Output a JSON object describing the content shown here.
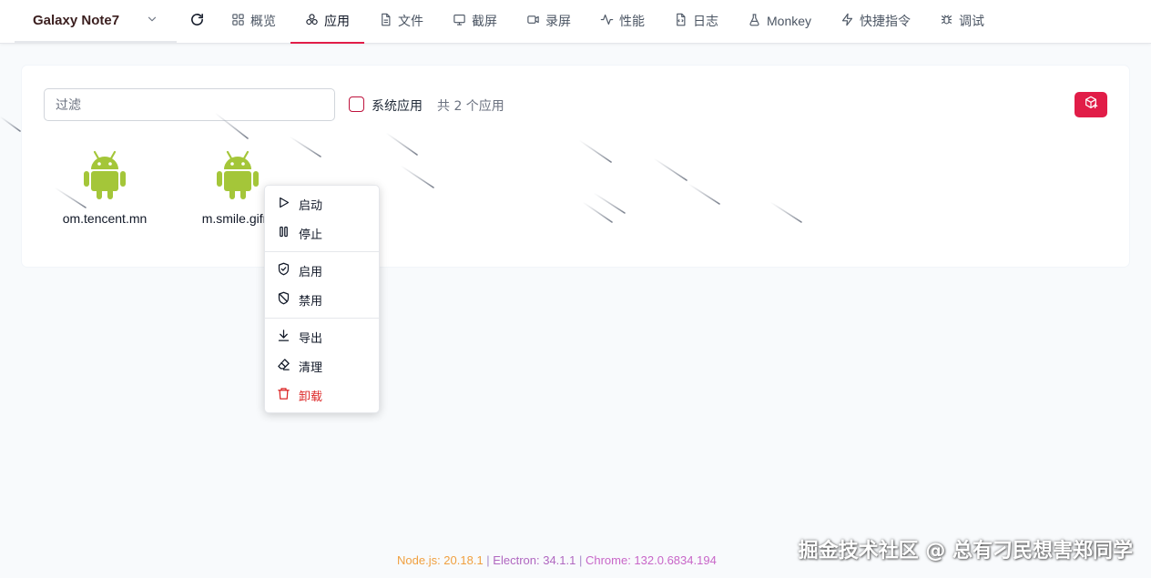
{
  "header": {
    "device_name": "Galaxy Note7",
    "tabs": [
      {
        "label": "概览",
        "icon": "grid-icon"
      },
      {
        "label": "应用",
        "icon": "apps-icon",
        "active": true
      },
      {
        "label": "文件",
        "icon": "file-icon"
      },
      {
        "label": "截屏",
        "icon": "screenshot-icon"
      },
      {
        "label": "录屏",
        "icon": "video-icon"
      },
      {
        "label": "性能",
        "icon": "pulse-icon"
      },
      {
        "label": "日志",
        "icon": "log-icon"
      },
      {
        "label": "Monkey",
        "icon": "flask-icon"
      },
      {
        "label": "快捷指令",
        "icon": "bolt-icon"
      },
      {
        "label": "调试",
        "icon": "bug-icon"
      }
    ]
  },
  "toolbar": {
    "filter_placeholder": "过滤",
    "system_apps_label": "系统应用",
    "system_apps_checked": false,
    "app_count_label": "共 2 个应用"
  },
  "apps": [
    {
      "name": "om.tencent.mn"
    },
    {
      "name": "m.smile.gifm"
    }
  ],
  "context_menu": {
    "items": [
      {
        "label": "启动",
        "icon": "play-icon"
      },
      {
        "label": "停止",
        "icon": "pause-icon"
      },
      {
        "label": "启用",
        "icon": "shield-check-icon"
      },
      {
        "label": "禁用",
        "icon": "shield-off-icon"
      },
      {
        "label": "导出",
        "icon": "download-icon"
      },
      {
        "label": "清理",
        "icon": "eraser-icon"
      },
      {
        "label": "卸载",
        "icon": "trash-icon",
        "danger": true
      }
    ]
  },
  "footer": {
    "node": "Node.js: 20.18.1",
    "electron": "Electron: 34.1.1",
    "chrome": "Chrome: 132.0.6834.194",
    "separator": " | "
  },
  "watermark": "掘金技术社区 @ 总有刁民想害郑同学",
  "colors": {
    "accent": "#e11d48",
    "android": "#a4c639",
    "danger": "#dc2626"
  }
}
